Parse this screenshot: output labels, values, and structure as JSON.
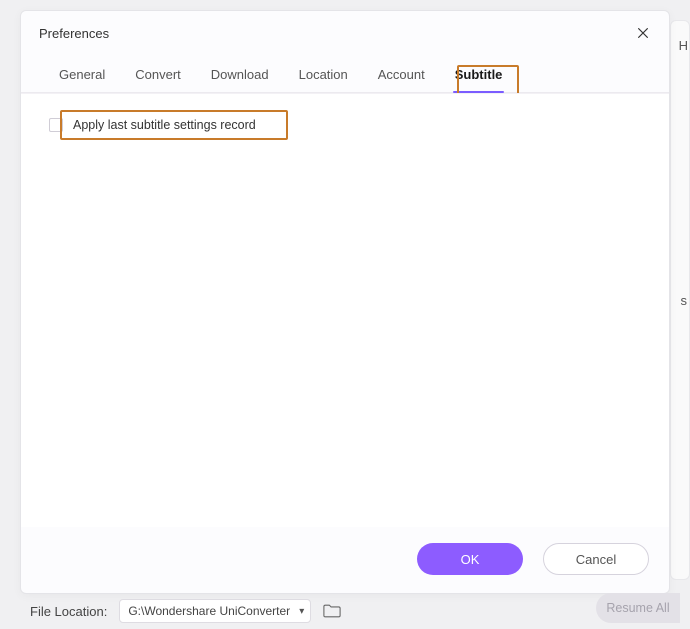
{
  "dialog": {
    "title": "Preferences",
    "tabs": {
      "general": "General",
      "convert": "Convert",
      "download": "Download",
      "location": "Location",
      "account": "Account",
      "subtitle": "Subtitle"
    },
    "checkbox_label": "Apply last subtitle settings record",
    "ok": "OK",
    "cancel": "Cancel"
  },
  "back": {
    "letter_h": "H",
    "letter_s": "s",
    "file_location_label": "File Location:",
    "path": "G:\\Wondershare UniConverter ",
    "resume": "Resume All"
  }
}
